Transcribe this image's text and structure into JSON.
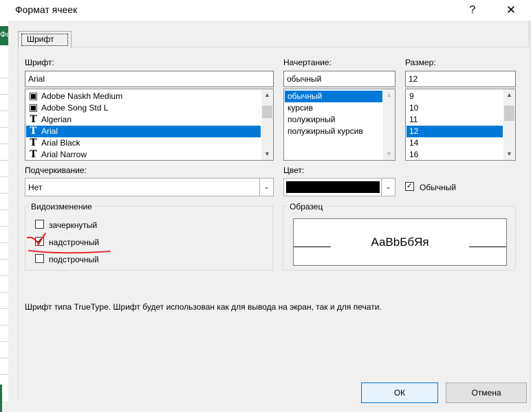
{
  "window": {
    "title": "Формат ячеек",
    "help": "?",
    "close": "✕"
  },
  "left_edge": {
    "text": "Фо"
  },
  "tab": {
    "label": "Шрифт"
  },
  "font": {
    "label": "Шрифт:",
    "value": "Arial",
    "items": [
      {
        "label": "Adobe Naskh Medium",
        "icon": "printer-font-icon",
        "glyph": "▣",
        "selected": false
      },
      {
        "label": "Adobe Song Std L",
        "icon": "printer-font-icon",
        "glyph": "▣",
        "selected": false
      },
      {
        "label": "Algerian",
        "icon": "truetype-font-icon",
        "glyph": "T",
        "selected": false
      },
      {
        "label": "Arial",
        "icon": "truetype-font-icon",
        "glyph": "T",
        "selected": true
      },
      {
        "label": "Arial Black",
        "icon": "truetype-font-icon",
        "glyph": "T",
        "selected": false
      },
      {
        "label": "Arial Narrow",
        "icon": "truetype-font-icon",
        "glyph": "T",
        "selected": false
      }
    ]
  },
  "style": {
    "label": "Начертание:",
    "value": "обычный",
    "items": [
      {
        "label": "обычный",
        "selected": true
      },
      {
        "label": "курсив",
        "selected": false
      },
      {
        "label": "полужирный",
        "selected": false
      },
      {
        "label": "полужирный курсив",
        "selected": false
      }
    ]
  },
  "size": {
    "label": "Размер:",
    "value": "12",
    "items": [
      {
        "label": "9",
        "selected": false
      },
      {
        "label": "10",
        "selected": false
      },
      {
        "label": "11",
        "selected": false
      },
      {
        "label": "12",
        "selected": true
      },
      {
        "label": "14",
        "selected": false
      },
      {
        "label": "16",
        "selected": false
      }
    ]
  },
  "underline": {
    "label": "Подчеркивание:",
    "value": "Нет"
  },
  "color": {
    "label": "Цвет:",
    "swatch": "#000000",
    "normal_label": "Обычный",
    "normal_checked": "✓"
  },
  "effects": {
    "label": "Видоизменение",
    "strike": {
      "label": "зачеркнутый",
      "mark": ""
    },
    "super": {
      "label": "надстрочный",
      "mark": "✓"
    },
    "sub": {
      "label": "подстрочный",
      "mark": ""
    }
  },
  "preview": {
    "label": "Образец",
    "text": "АаВbБбЯя"
  },
  "info": "Шрифт типа TrueType. Шрифт будет использован как для вывода на экран, так и для печати.",
  "buttons": {
    "ok": "ОК",
    "cancel": "Отмена"
  },
  "colors": {
    "accent": "#0078d7",
    "annotation": "#e31b1b",
    "excel_green": "#217346"
  }
}
